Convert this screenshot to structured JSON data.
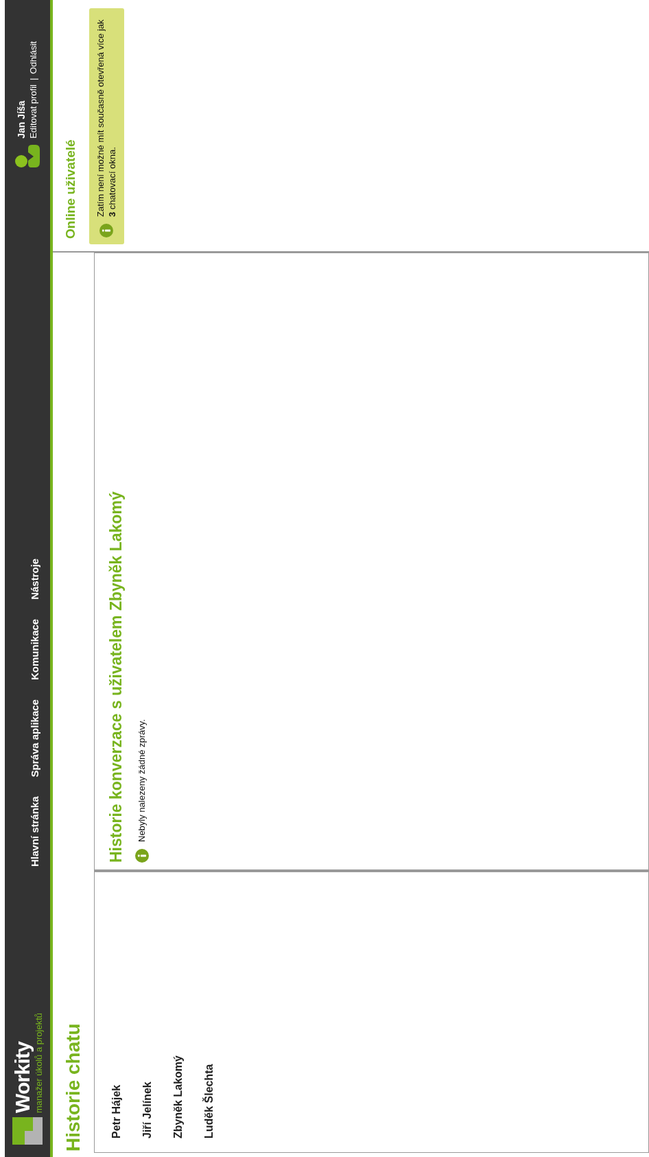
{
  "header": {
    "logo": {
      "name": "Workity",
      "tagline": "manažer úkolů a projektů"
    },
    "nav": [
      {
        "label": "Hlavní stránka"
      },
      {
        "label": "Správa aplikace"
      },
      {
        "label": "Komunikace"
      },
      {
        "label": "Nástroje"
      }
    ],
    "user": {
      "name": "Jan Jíša",
      "links": [
        "Editovat profil",
        "Odhlásit"
      ],
      "separator": "|"
    }
  },
  "page_title": "Historie chatu",
  "contacts": [
    {
      "name": "Petr Hájek"
    },
    {
      "name": "Jiří Jelínek"
    },
    {
      "name": "Zbyněk Lakomý"
    },
    {
      "name": "Luděk Šlechta"
    }
  ],
  "conversation": {
    "title": "Historie konverzace s uživatelem Zbyněk Lakomý",
    "notice": "Nebyly nalezeny žádné zprávy."
  },
  "sidebar": {
    "title": "Online uživatelé",
    "notice": "Zatím není možné mít současně otevřená více jak **3** chatovací okna."
  }
}
